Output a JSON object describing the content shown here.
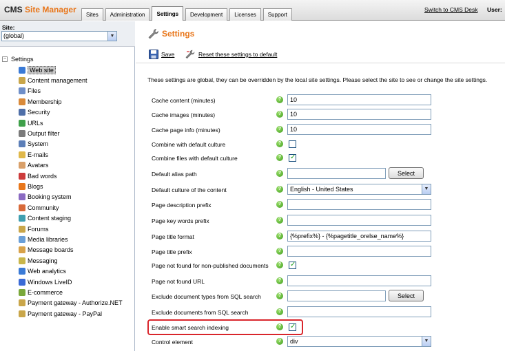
{
  "app": {
    "logo_cms": "CMS",
    "logo_site_manager": "Site Manager",
    "switch_link": "Switch to CMS Desk",
    "user_label": "User:"
  },
  "tabs": [
    {
      "label": "Sites",
      "active": false
    },
    {
      "label": "Administration",
      "active": false
    },
    {
      "label": "Settings",
      "active": true
    },
    {
      "label": "Development",
      "active": false
    },
    {
      "label": "Licenses",
      "active": false
    },
    {
      "label": "Support",
      "active": false
    }
  ],
  "site": {
    "label": "Site:",
    "value": "(global)"
  },
  "tree": {
    "root": "Settings",
    "items": [
      {
        "label": "Web site",
        "icon": "globe-icon",
        "color": "#3a7ad6",
        "selected": true
      },
      {
        "label": "Content management",
        "icon": "document-edit-icon",
        "color": "#c9a64a"
      },
      {
        "label": "Files",
        "icon": "files-icon",
        "color": "#6f8fc9"
      },
      {
        "label": "Membership",
        "icon": "member-icon",
        "color": "#d98a3a"
      },
      {
        "label": "Security",
        "icon": "security-icon",
        "color": "#4f6fa8"
      },
      {
        "label": "URLs",
        "icon": "url-icon",
        "color": "#3fa04a"
      },
      {
        "label": "Output filter",
        "icon": "filter-icon",
        "color": "#7a7a7a"
      },
      {
        "label": "System",
        "icon": "system-icon",
        "color": "#5c7fb8"
      },
      {
        "label": "E-mails",
        "icon": "email-icon",
        "color": "#e0b84a"
      },
      {
        "label": "Avatars",
        "icon": "avatar-icon",
        "color": "#d9a06a"
      },
      {
        "label": "Bad words",
        "icon": "bad-words-icon",
        "color": "#cc3b3b"
      },
      {
        "label": "Blogs",
        "icon": "blog-icon",
        "color": "#e8761a"
      },
      {
        "label": "Booking system",
        "icon": "booking-icon",
        "color": "#8a6ac2"
      },
      {
        "label": "Community",
        "icon": "community-icon",
        "color": "#d86a3a"
      },
      {
        "label": "Content staging",
        "icon": "staging-icon",
        "color": "#3f9fb0"
      },
      {
        "label": "Forums",
        "icon": "forum-icon",
        "color": "#c9a64a"
      },
      {
        "label": "Media libraries",
        "icon": "media-icon",
        "color": "#6a9fd8"
      },
      {
        "label": "Message boards",
        "icon": "message-board-icon",
        "color": "#d8a24a"
      },
      {
        "label": "Messaging",
        "icon": "messaging-icon",
        "color": "#c9b64a"
      },
      {
        "label": "Web analytics",
        "icon": "analytics-icon",
        "color": "#3a7ad6"
      },
      {
        "label": "Windows LiveID",
        "icon": "liveid-icon",
        "color": "#3a6ad6"
      },
      {
        "label": "E-commerce",
        "icon": "ecommerce-icon",
        "color": "#7aa83a"
      },
      {
        "label": "Payment gateway - Authorize.NET",
        "icon": "payment-icon",
        "color": "#c9a64a"
      },
      {
        "label": "Payment gateway - PayPal",
        "icon": "payment-icon",
        "color": "#c9a64a"
      }
    ]
  },
  "main": {
    "title": "Settings",
    "save_label": "Save",
    "reset_label": "Reset these settings to default",
    "info": "These settings are global, they can be overridden by the local site settings. Please select the site to see or change the site settings.",
    "help_glyph": "?",
    "select_label": "Select",
    "rows": [
      {
        "label": "Cache content (minutes)",
        "type": "text",
        "value": "10"
      },
      {
        "label": "Cache images (minutes)",
        "type": "text",
        "value": "10"
      },
      {
        "label": "Cache page info (minutes)",
        "type": "text",
        "value": "10"
      },
      {
        "label": "Combine with default culture",
        "type": "checkbox",
        "checked": false
      },
      {
        "label": "Combine files with default culture",
        "type": "checkbox",
        "checked": true
      },
      {
        "label": "Default alias path",
        "type": "text-select",
        "value": ""
      },
      {
        "label": "Default culture of the content",
        "type": "dropdown",
        "value": "English - United States"
      },
      {
        "label": "Page description prefix",
        "type": "text",
        "value": ""
      },
      {
        "label": "Page key words prefix",
        "type": "text",
        "value": ""
      },
      {
        "label": "Page title format",
        "type": "text",
        "value": "{%prefix%} - {%pagetitle_orelse_name%}"
      },
      {
        "label": "Page title prefix",
        "type": "text",
        "value": ""
      },
      {
        "label": "Page not found for non-published documents",
        "type": "checkbox",
        "checked": true
      },
      {
        "label": "Page not found URL",
        "type": "text",
        "value": ""
      },
      {
        "label": "Exclude document types from SQL search",
        "type": "text-select",
        "value": ""
      },
      {
        "label": "Exclude documents from SQL search",
        "type": "text",
        "value": ""
      },
      {
        "label": "Enable smart search indexing",
        "type": "checkbox",
        "checked": true
      },
      {
        "label": "Control element",
        "type": "dropdown",
        "value": "div"
      }
    ]
  }
}
